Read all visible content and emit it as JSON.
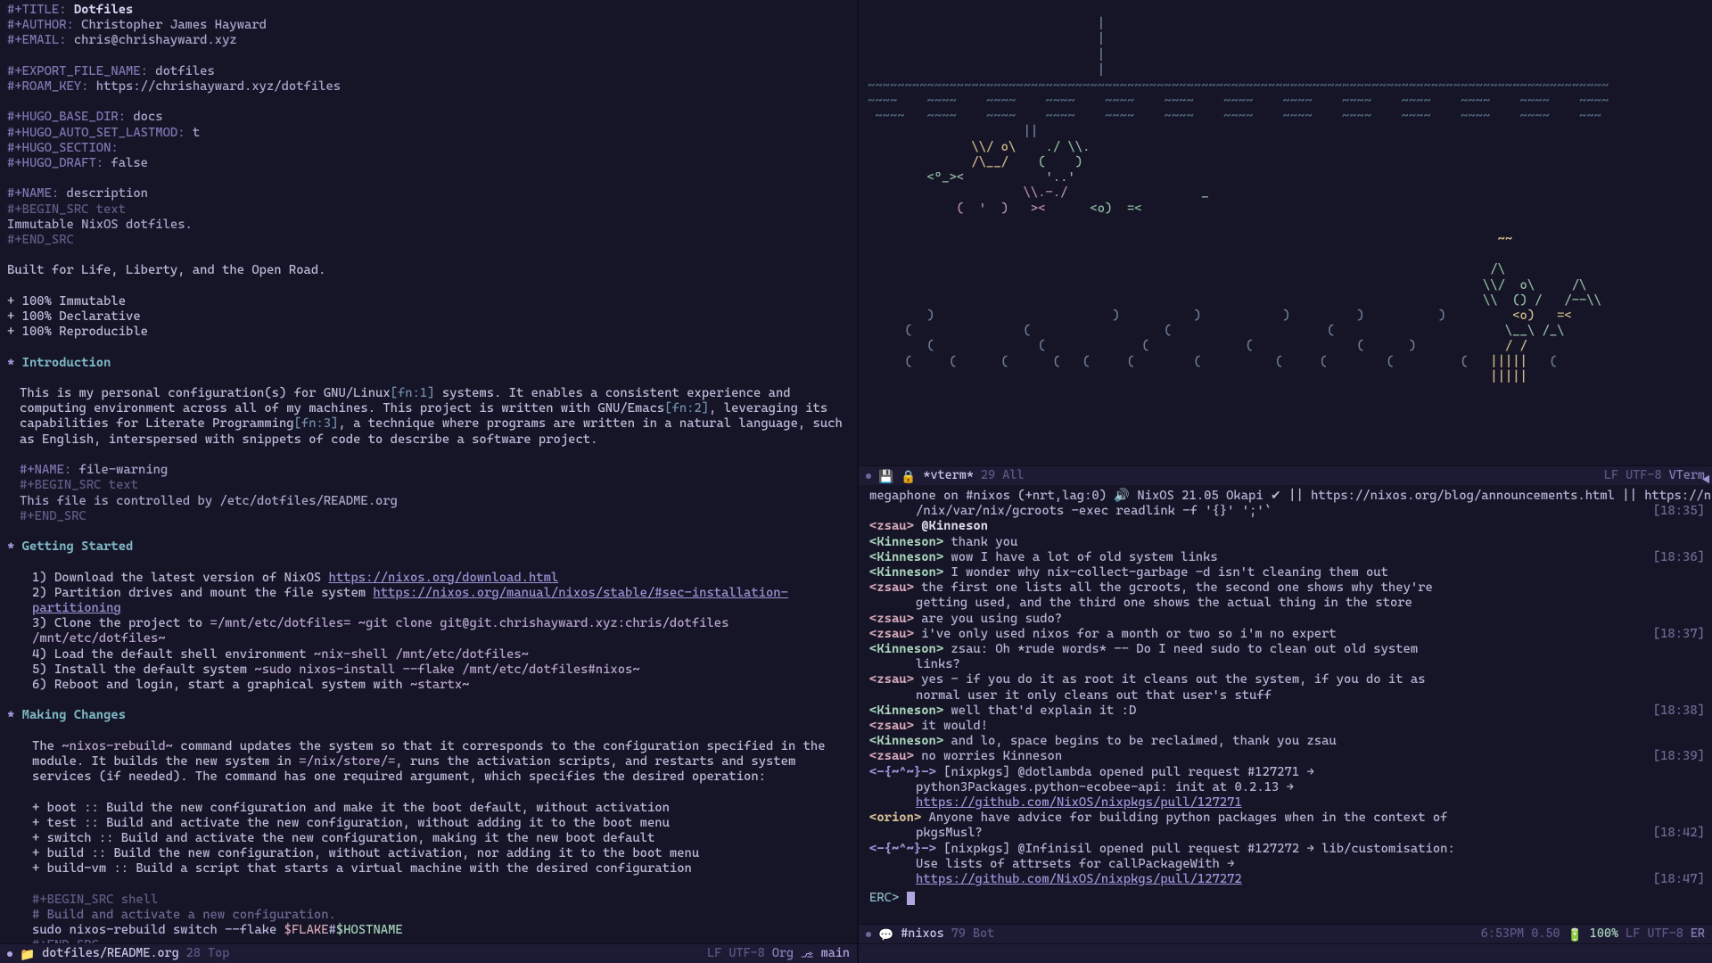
{
  "org": {
    "title_kw": "#+TITLE:",
    "title": "Dotfiles",
    "author_kw": "#+AUTHOR:",
    "author": "Christopher James Hayward",
    "email_kw": "#+EMAIL:",
    "email": "chris@chrishayward.xyz",
    "export_kw": "#+EXPORT_FILE_NAME:",
    "export": "dotfiles",
    "roam_kw": "#+ROAM_KEY:",
    "roam": "https://chrishayward.xyz/dotfiles",
    "hbase_kw": "#+HUGO_BASE_DIR:",
    "hbase": "docs",
    "hlast_kw": "#+HUGO_AUTO_SET_LASTMOD:",
    "hlast": "t",
    "hsect_kw": "#+HUGO_SECTION:",
    "hdraft_kw": "#+HUGO_DRAFT:",
    "hdraft": "false",
    "name1_kw": "#+NAME:",
    "name1": "description",
    "begin_text": "#+BEGIN_SRC text",
    "desc_body": "Immutable NixOS dotfiles.",
    "end_src": "#+END_SRC",
    "tagline": "Built for Life, Liberty, and the Open Road.",
    "bullets3": [
      "+ 100% Immutable",
      "+ 100% Declarative",
      "+ 100% Reproducible"
    ],
    "h1": "Introduction",
    "intro1": "This is my personal configuration(s) for GNU/Linux",
    "fn1": "[fn:1]",
    "intro2": " systems. It enables a consistent experience and computing environment across all of my machines. This project is written with GNU/Emacs",
    "fn2": "[fn:2]",
    "intro3": ", leveraging its capabilities for Literate Programming",
    "fn3": "[fn:3]",
    "intro4": ", a technique where programs are written in a natural language, such as English, interspersed with snippets of code to describe a software project.",
    "name2_kw": "#+NAME:",
    "name2": "file-warning",
    "fw_body": "This file is controlled by /etc/dotfiles/README.org",
    "h2": "Getting Started",
    "steps": {
      "s1a": "1) Download the latest version of NixOS ",
      "s1l": "https://nixos.org/download.html",
      "s2a": "2) Partition drives and mount the file system ",
      "s2l": "https://nixos.org/manual/nixos/stable/#sec-installation-partitioning",
      "s3a": "3) Clone the project to ",
      "s3p": "=/mnt/etc/dotfiles= ",
      "s3c": "~git clone git@git.chrishayward.xyz:chris/dotfiles /mnt/etc/dotfiles~",
      "s4a": "4) Load the default shell environment ",
      "s4c": "~nix-shell /mnt/etc/dotfiles~",
      "s5a": "5) Install the default system ",
      "s5c": "~sudo nixos-install --flake /mnt/etc/dotfiles#nixos~",
      "s6a": "6) Reboot and login, start a graphical system with ",
      "s6c": "~startx~"
    },
    "h3": "Making Changes",
    "mc1a": "The ",
    "mc1c": "~nixos-rebuild~",
    "mc1b": " command updates the system so that it corresponds to the configuration specified in the module. It builds the new system in ",
    "mc1p": "=/nix/store/=",
    "mc1d": ", runs the activation scripts, and restarts and system services (if needed). The command has one required argument, which specifies the desired operation:",
    "ops": [
      "+ boot :: Build the new configuration and make it the boot default, without activation",
      "+ test :: Build and activate the new configuration, without adding it to the boot menu",
      "+ switch :: Build and activate the new configuration, making it the new boot default",
      "+ build :: Build the new configuration, without activation, nor adding it to the boot menu",
      "+ build-vm :: Build a script that starts a virtual machine with the desired configuration"
    ],
    "begin_shell": "#+BEGIN_SRC shell",
    "sh_comment": "# Build and activate a new configuration.",
    "sh_cmd_a": "sudo nixos-rebuild switch --flake ",
    "sh_var1": "$FLAKE",
    "sh_hash": "#",
    "sh_var2": "$HOSTNAME"
  },
  "vterm_modeline": {
    "buf": "*vterm*",
    "pos": "29 All",
    "enc": "LF UTF-8",
    "mode": "VTerm"
  },
  "irc": {
    "topic1": "megaphone on #nixos (+nrt,lag:0) ",
    "topic2": " NixOS 21.05 Okapi ",
    "topic3": " || https://nixos.org/blog/announcements.html || https://nixos.org || Latest NixO",
    "topic4": "/nix/var/nix/gcroots -exec readlink -f '{}' ';'`",
    "rows": [
      {
        "n": "zsau",
        "c": "nick-z",
        "t": "",
        "m": "@Kinneson",
        "ts": "[18:35]"
      },
      {
        "n": "Kinneson",
        "c": "nick-k",
        "t": "",
        "m": "thank you",
        "ts": ""
      },
      {
        "n": "Kinneson",
        "c": "nick-k",
        "t": "",
        "m": "wow I have a lot of old system links",
        "ts": "[18:36]"
      },
      {
        "n": "Kinneson",
        "c": "nick-k",
        "t": "",
        "m": "I wonder why nix-collect-garbage -d isn't cleaning them out",
        "ts": ""
      },
      {
        "n": "zsau",
        "c": "nick-z",
        "t": "",
        "m": "the first one lists all the gcroots, the second one shows why they're",
        "ts": ""
      },
      {
        "n": "",
        "c": "",
        "t": "cont",
        "m": "getting used, and the third one shows the actual thing in the store",
        "ts": ""
      },
      {
        "n": "zsau",
        "c": "nick-z",
        "t": "",
        "m": "are you using sudo?",
        "ts": ""
      },
      {
        "n": "zsau",
        "c": "nick-z",
        "t": "",
        "m": "i've only used nixos for a month or two so i'm no expert",
        "ts": "[18:37]"
      },
      {
        "n": "Kinneson",
        "c": "nick-k",
        "t": "",
        "m": "zsau: Oh *rude words* -- Do I need sudo to clean out old system",
        "ts": ""
      },
      {
        "n": "",
        "c": "",
        "t": "cont",
        "m": "links?",
        "ts": ""
      },
      {
        "n": "zsau",
        "c": "nick-z",
        "t": "",
        "m": "yes - if you do it as root it cleans out the system, if you do it as",
        "ts": ""
      },
      {
        "n": "",
        "c": "",
        "t": "cont",
        "m": "normal user it only cleans out that user's stuff",
        "ts": ""
      },
      {
        "n": "Kinneson",
        "c": "nick-k",
        "t": "",
        "m": "well that'd explain it :D",
        "ts": "[18:38]"
      },
      {
        "n": "zsau",
        "c": "nick-z",
        "t": "",
        "m": "it would!",
        "ts": ""
      },
      {
        "n": "Kinneson",
        "c": "nick-k",
        "t": "",
        "m": "and lo, space begins to be reclaimed, thank you zsau",
        "ts": ""
      },
      {
        "n": "zsau",
        "c": "nick-z",
        "t": "",
        "m": "no worries Kinneson",
        "ts": "[18:39]"
      },
      {
        "n": "-{~^~}-",
        "c": "nick-b",
        "t": "bot",
        "m": "[nixpkgs] @dotlambda opened pull request #127271 →",
        "ts": ""
      },
      {
        "n": "",
        "c": "",
        "t": "cont",
        "m": "python3Packages.python-ecobee-api: init at 0.2.13 →",
        "ts": ""
      },
      {
        "n": "",
        "c": "",
        "t": "url",
        "m": "https://github.com/NixOS/nixpkgs/pull/127271",
        "ts": ""
      },
      {
        "n": "orion",
        "c": "nick-o",
        "t": "",
        "m": "Anyone have advice for building python packages when in the context of",
        "ts": ""
      },
      {
        "n": "",
        "c": "",
        "t": "cont",
        "m": "pkgsMusl?",
        "ts": "[18:42]"
      },
      {
        "n": "-{~^~}-",
        "c": "nick-b",
        "t": "bot",
        "m": "[nixpkgs] @Infinisil opened pull request #127272 → lib/customisation:",
        "ts": ""
      },
      {
        "n": "",
        "c": "",
        "t": "cont",
        "m": "Use lists of attrsets for callPackageWith →",
        "ts": ""
      },
      {
        "n": "",
        "c": "",
        "t": "url",
        "m": "https://github.com/NixOS/nixpkgs/pull/127272",
        "ts": "[18:47]"
      }
    ],
    "prompt": "ERC> "
  },
  "irc_modeline": {
    "buf": "#nixos",
    "pos": "79 Bot",
    "clock": "6:53PM 0.50",
    "batt": "100%",
    "enc": "LF UTF-8",
    "mode": "ER"
  },
  "org_modeline": {
    "buf": "dotfiles/README.org",
    "pos": "28 Top",
    "enc": "LF UTF-8",
    "mode": "Org",
    "git": "main"
  }
}
